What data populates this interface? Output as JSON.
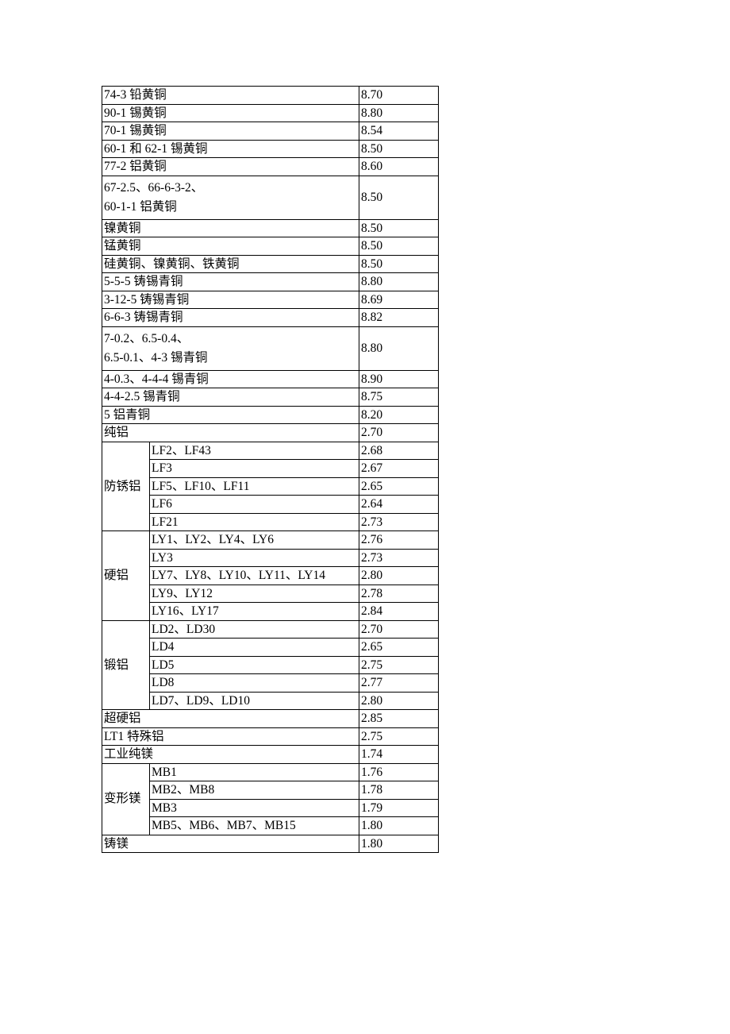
{
  "rows": [
    {
      "name": "74-3 铅黄铜",
      "value": "8.70"
    },
    {
      "name": "90-1 锡黄铜",
      "value": "8.80"
    },
    {
      "name": "70-1 锡黄铜",
      "value": "8.54"
    },
    {
      "name": "60-1 和 62-1 锡黄铜",
      "value": "8.50"
    },
    {
      "name": "77-2 铝黄铜",
      "value": "8.60"
    },
    {
      "name_html": "67-2.5、66-6-3-2、<br>60-1-1 铝黄铜",
      "value": "8.50",
      "multi": true
    },
    {
      "name": "镍黄铜",
      "value": "8.50"
    },
    {
      "name": "锰黄铜",
      "value": "8.50"
    },
    {
      "name": "硅黄铜、镍黄铜、铁黄铜",
      "value": "8.50"
    },
    {
      "name": "5-5-5 铸锡青铜",
      "value": "8.80"
    },
    {
      "name": "3-12-5 铸锡青铜",
      "value": "8.69"
    },
    {
      "name": "6-6-3 铸锡青铜",
      "value": "8.82"
    },
    {
      "name_html": "7-0.2、6.5-0.4、<br>6.5-0.1、4-3 锡青铜",
      "value": "8.80",
      "multi": true
    },
    {
      "name": "4-0.3、4-4-4 锡青铜",
      "value": "8.90"
    },
    {
      "name": "4-4-2.5 锡青铜",
      "value": "8.75"
    },
    {
      "name": "5 铝青铜",
      "value": "8.20"
    },
    {
      "name": "纯铝",
      "value": "2.70"
    },
    {
      "group": "防锈铝",
      "sub": [
        {
          "name": "LF2、LF43",
          "value": "2.68"
        },
        {
          "name": "LF3",
          "value": "2.67"
        },
        {
          "name": "LF5、LF10、LF11",
          "value": "2.65"
        },
        {
          "name": "LF6",
          "value": "2.64"
        },
        {
          "name": "LF21",
          "value": "2.73"
        }
      ]
    },
    {
      "group": "硬铝",
      "sub": [
        {
          "name": "LY1、LY2、LY4、LY6",
          "value": "2.76"
        },
        {
          "name": "LY3",
          "value": "2.73"
        },
        {
          "name": "LY7、LY8、LY10、LY11、LY14",
          "value": "2.80"
        },
        {
          "name": "LY9、LY12",
          "value": "2.78"
        },
        {
          "name": "LY16、LY17",
          "value": "2.84"
        }
      ]
    },
    {
      "group": "锻铝",
      "sub": [
        {
          "name": "LD2、LD30",
          "value": "2.70"
        },
        {
          "name": "LD4",
          "value": "2.65"
        },
        {
          "name": "LD5",
          "value": "2.75"
        },
        {
          "name": "LD8",
          "value": "2.77"
        },
        {
          "name": "LD7、LD9、LD10",
          "value": "2.80"
        }
      ]
    },
    {
      "name": "超硬铝",
      "value": "2.85"
    },
    {
      "name": "LT1 特殊铝",
      "value": "2.75"
    },
    {
      "name": "工业纯镁",
      "value": "1.74"
    },
    {
      "group": "变形镁",
      "sub": [
        {
          "name": "MB1",
          "value": "1.76"
        },
        {
          "name": "MB2、MB8",
          "value": "1.78"
        },
        {
          "name": "MB3",
          "value": "1.79"
        },
        {
          "name": "MB5、MB6、MB7、MB15",
          "value": "1.80"
        }
      ]
    },
    {
      "name": "铸镁",
      "value": "1.80"
    }
  ]
}
